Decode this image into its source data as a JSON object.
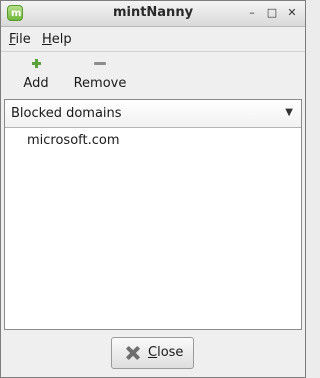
{
  "window": {
    "title": "mintNanny",
    "controls": {
      "minimize": "–",
      "maximize": "□",
      "close": "✕"
    }
  },
  "menu": {
    "file": {
      "mnemonic": "F",
      "rest": "ile"
    },
    "help": {
      "mnemonic": "H",
      "rest": "elp"
    }
  },
  "toolbar": {
    "add_label": "Add",
    "remove_label": "Remove"
  },
  "combo": {
    "selected": "Blocked domains",
    "arrow": "▼"
  },
  "domains": [
    "microsoft.com"
  ],
  "footer": {
    "close_mnemonic": "C",
    "close_rest": "lose"
  },
  "icons": {
    "app": "mint-leaf-icon",
    "add": "plus-icon",
    "remove": "minus-icon",
    "close": "close-icon"
  },
  "colors": {
    "accent_green": "#5ba23a",
    "titlebar": "#dcdcdc"
  }
}
